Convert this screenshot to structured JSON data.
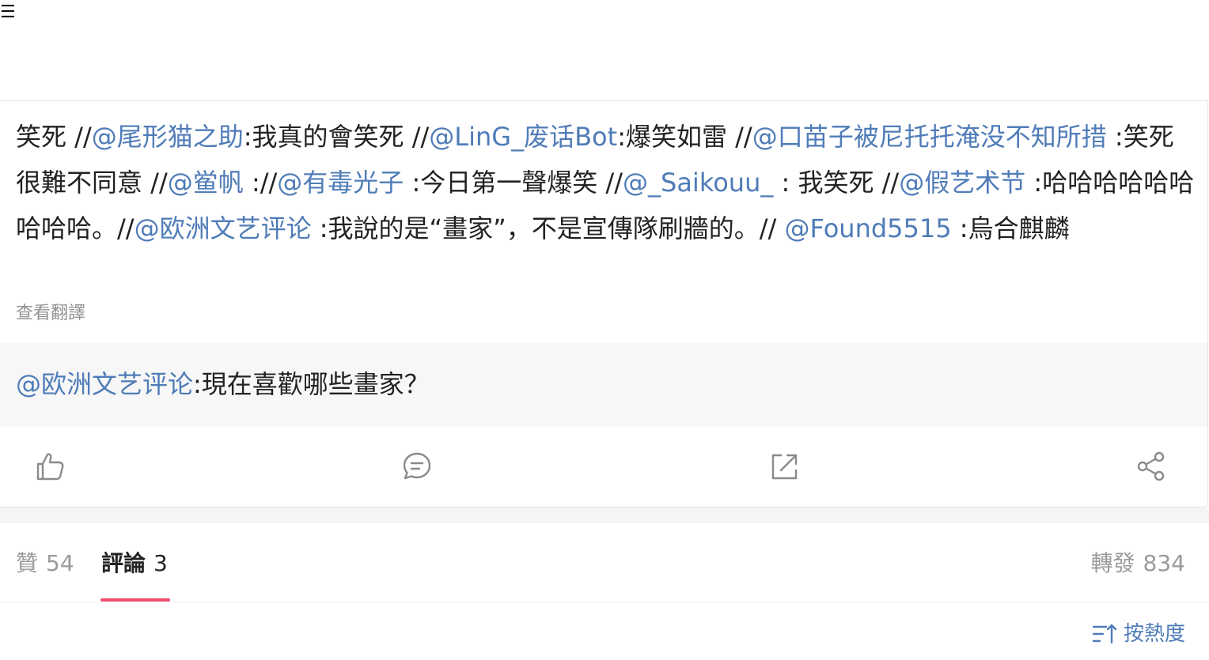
{
  "header": {
    "menu_icon": "☰"
  },
  "post": {
    "segments": [
      {
        "t": "笑死 //",
        "m": false
      },
      {
        "t": "@尾形猫之助",
        "m": true
      },
      {
        "t": ":我真的會笑死 //",
        "m": false
      },
      {
        "t": "@LinG_废话Bot",
        "m": true
      },
      {
        "t": ":爆笑如雷 //",
        "m": false
      },
      {
        "t": "@口苗子被尼托托淹没不知所措",
        "m": true
      },
      {
        "t": " :笑死很難不同意 //",
        "m": false
      },
      {
        "t": "@鲎帆",
        "m": true
      },
      {
        "t": " ://",
        "m": false
      },
      {
        "t": "@有毒光子",
        "m": true
      },
      {
        "t": " :今日第一聲爆笑 //",
        "m": false
      },
      {
        "t": "@_Saikouu_",
        "m": true
      },
      {
        "t": " : 我笑死 //",
        "m": false
      },
      {
        "t": "@假艺术节",
        "m": true
      },
      {
        "t": " :哈哈哈哈哈哈哈哈哈。//",
        "m": false
      },
      {
        "t": "@欧洲文艺评论",
        "m": true
      },
      {
        "t": " :我說的是“畫家”，不是宣傳隊刷牆的。// ",
        "m": false
      },
      {
        "t": "@Found5515",
        "m": true
      },
      {
        "t": " :烏合麒麟",
        "m": false
      }
    ],
    "translate_label": "查看翻譯"
  },
  "quoted": {
    "mention": "@欧洲文艺评论",
    "text": ":現在喜歡哪些畫家？"
  },
  "actions": {
    "icons": [
      "thumbs-up-icon",
      "comment-icon",
      "repost-icon",
      "share-icon"
    ]
  },
  "tabs": {
    "likes": {
      "label": "贊",
      "count": "54"
    },
    "comments": {
      "label": "評論",
      "count": "3"
    },
    "reposts": {
      "label": "轉發",
      "count": "834"
    }
  },
  "sort": {
    "label": "按熱度"
  },
  "colors": {
    "mention": "#4f7cb8",
    "indicator": "#f0506e",
    "muted": "#9a9a9a"
  }
}
